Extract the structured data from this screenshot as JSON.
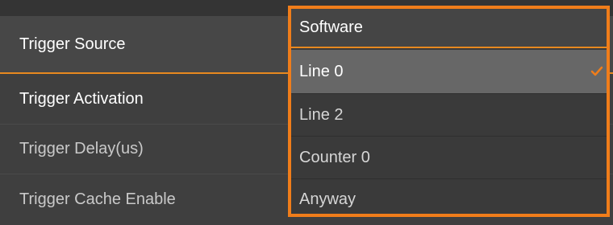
{
  "properties": [
    {
      "label": "Trigger Source"
    },
    {
      "label": "Trigger Activation"
    },
    {
      "label": "Trigger Delay(us)"
    },
    {
      "label": "Trigger Cache Enable"
    }
  ],
  "dropdown": {
    "selected_value": "Software",
    "options": [
      "Line 0",
      "Line 2",
      "Counter 0",
      "Anyway"
    ],
    "highlighted_option": "Line 0"
  },
  "colors": {
    "accent": "#f07d1a",
    "panel_bg": "#3f3f3f",
    "highlight_bg": "#676767"
  },
  "icons": {
    "highlight_marker": "check-icon"
  }
}
